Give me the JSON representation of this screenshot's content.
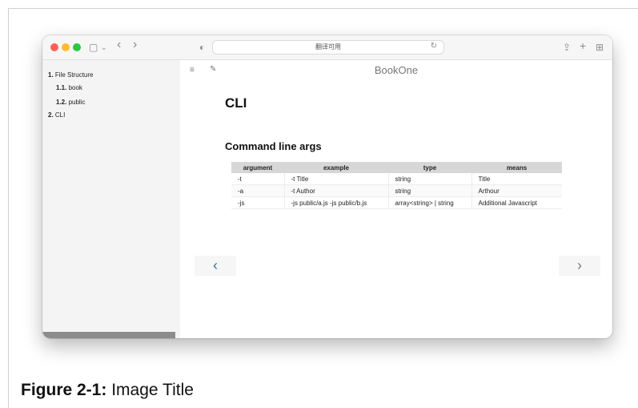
{
  "browser": {
    "address_text": "翻译可用",
    "reload_glyph": "↻",
    "nav_back_glyph": "‹",
    "nav_forward_glyph": "›",
    "shield_glyph": "◐",
    "sidebar_glyph": "▢",
    "share_glyph": "⇪",
    "new_tab_glyph": "+",
    "tabs_glyph": "⊞",
    "chevron_glyph": "⌄"
  },
  "sidebar": {
    "items": [
      {
        "num": "1.",
        "label": "File Structure"
      },
      {
        "num": "1.1.",
        "label": "book"
      },
      {
        "num": "1.2.",
        "label": "public"
      },
      {
        "num": "2.",
        "label": "CLI"
      }
    ]
  },
  "content": {
    "book_title": "BookOne",
    "menu_glyph": "≡",
    "edit_glyph": "✎",
    "heading": "CLI",
    "subheading": "Command line args",
    "table": {
      "headers": [
        "argument",
        "example",
        "type",
        "means"
      ],
      "rows": [
        [
          "-t",
          "-t Title",
          "string",
          "Title"
        ],
        [
          "-a",
          "-t Author",
          "string",
          "Arthour"
        ],
        [
          "-js",
          "-js public/a.js -js public/b.js",
          "array<string> | string",
          "Additional Javascript"
        ]
      ]
    },
    "prev_glyph": "‹",
    "next_glyph": "›"
  },
  "caption": {
    "label": "Figure 2-1:",
    "text": "Image Title"
  }
}
